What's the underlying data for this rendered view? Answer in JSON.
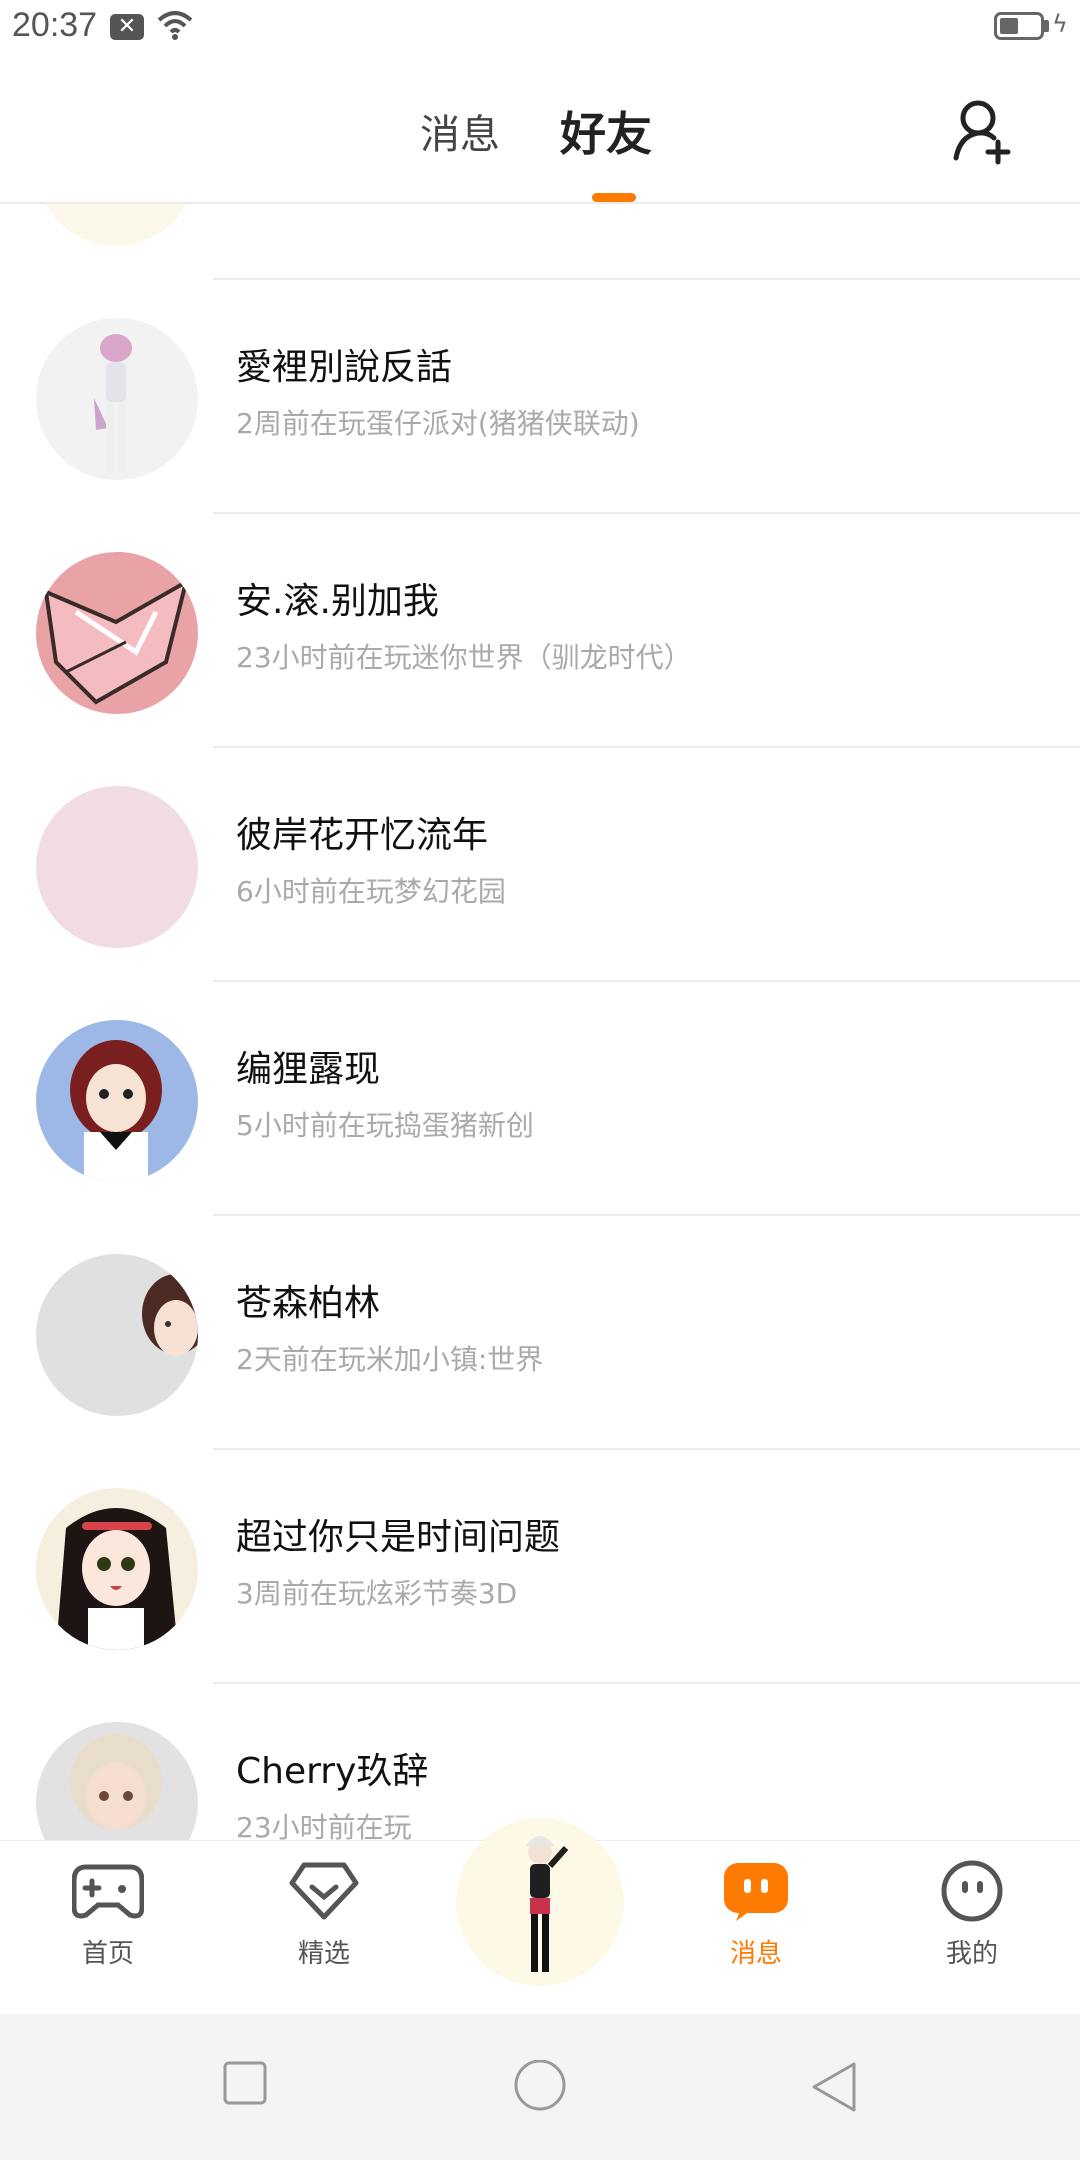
{
  "status_bar": {
    "time": "20:37",
    "battery_level": 0.4
  },
  "header": {
    "tabs": [
      {
        "label": "消息",
        "active": false
      },
      {
        "label": "好友",
        "active": true
      }
    ],
    "add_friend_icon": "add-user-icon"
  },
  "friends": [
    {
      "name": "愛裡別說反話",
      "status": "2周前在玩蛋仔派对(猪猪侠联动)",
      "avatar_color": "#f2f2f2"
    },
    {
      "name": "安.滚.别加我",
      "status": "23小时前在玩迷你世界（驯龙时代）",
      "avatar_color": "#e9a3a6"
    },
    {
      "name": "彼岸花开忆流年",
      "status": "6小时前在玩梦幻花园",
      "avatar_color": "#f1dde1"
    },
    {
      "name": "编狸露现",
      "status": "5小时前在玩捣蛋猪新创",
      "avatar_color": "#9db7e6"
    },
    {
      "name": "苍森柏林",
      "status": "2天前在玩米加小镇:世界",
      "avatar_color": "#e0e0e0"
    },
    {
      "name": "超过你只是时间问题",
      "status": "3周前在玩炫彩节奏3D",
      "avatar_color": "#f6eedf"
    },
    {
      "name": "Cherry玖辞",
      "status": "23小时前在玩",
      "avatar_color": "#e2e2e2"
    }
  ],
  "bottom_nav": {
    "items": [
      {
        "label": "首页",
        "icon": "gamepad-icon",
        "active": false
      },
      {
        "label": "精选",
        "icon": "heart-gem-icon",
        "active": false
      },
      {
        "label": "消息",
        "icon": "chat-bubble-icon",
        "active": true
      },
      {
        "label": "我的",
        "icon": "face-icon",
        "active": false
      }
    ],
    "accent_color": "#ff7a00"
  },
  "system_nav": {
    "buttons": [
      "recent-apps-icon",
      "home-icon",
      "back-icon"
    ]
  }
}
